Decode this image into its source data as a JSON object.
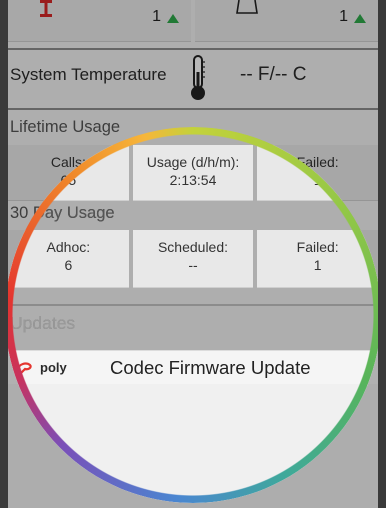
{
  "top": {
    "left_value": "1",
    "right_value": "1"
  },
  "system_temperature": {
    "label": "System Temperature",
    "value": "-- F/-- C"
  },
  "lifetime": {
    "title": "Lifetime Usage",
    "cells": [
      {
        "label": "Calls:",
        "value": "65"
      },
      {
        "label": "Usage (d/h/m):",
        "value": "2:13:54"
      },
      {
        "label": "Failed:",
        "value": "1"
      }
    ]
  },
  "thirty_day": {
    "title": "30 Day Usage",
    "cells": [
      {
        "label": "Adhoc:",
        "value": "6"
      },
      {
        "label": "Scheduled:",
        "value": "--"
      },
      {
        "label": "Failed:",
        "value": "1"
      }
    ]
  },
  "updates": {
    "title": "Updates",
    "brand": "poly",
    "item_label": "Codec Firmware Update"
  },
  "colors": {
    "accent_green": "#2ea84a",
    "poly_red": "#e4352f",
    "mic_red": "#d62828"
  },
  "icons": [
    "microphone-icon",
    "bell-icon",
    "thermometer-icon",
    "up-arrow-icon",
    "poly-logo-icon"
  ]
}
